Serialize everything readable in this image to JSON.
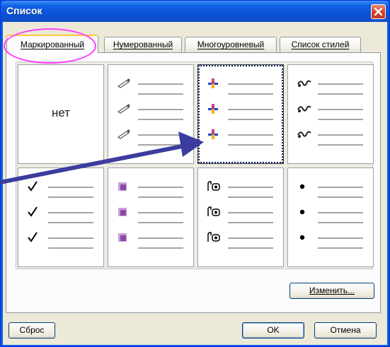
{
  "window": {
    "title": "Список"
  },
  "tabs": [
    {
      "label": "Маркированный",
      "active": true
    },
    {
      "label": "Нумерованный",
      "active": false
    },
    {
      "label": "Многоуровневый",
      "active": false
    },
    {
      "label": "Список стилей",
      "active": false
    }
  ],
  "gallery": {
    "none_label": "нет",
    "cells": [
      {
        "name": "none",
        "icon": "none"
      },
      {
        "name": "pencil",
        "icon": "pencil-icon"
      },
      {
        "name": "colored-cross",
        "icon": "colored-cross-icon",
        "selected": true
      },
      {
        "name": "ornament",
        "icon": "ornament-icon"
      },
      {
        "name": "checkmark",
        "icon": "checkmark-icon"
      },
      {
        "name": "square-3d",
        "icon": "purple-square-icon"
      },
      {
        "name": "mailbox",
        "icon": "mailbox-icon"
      },
      {
        "name": "dot",
        "icon": "dot-icon"
      }
    ]
  },
  "buttons": {
    "modify": "Изменить...",
    "reset": "Сброс",
    "ok": "OK",
    "cancel": "Отмена"
  },
  "colors": {
    "titlebar": "#0a54d8",
    "annotation_ellipse": "#ff3cff",
    "annotation_arrow": "#3c3ca0"
  }
}
